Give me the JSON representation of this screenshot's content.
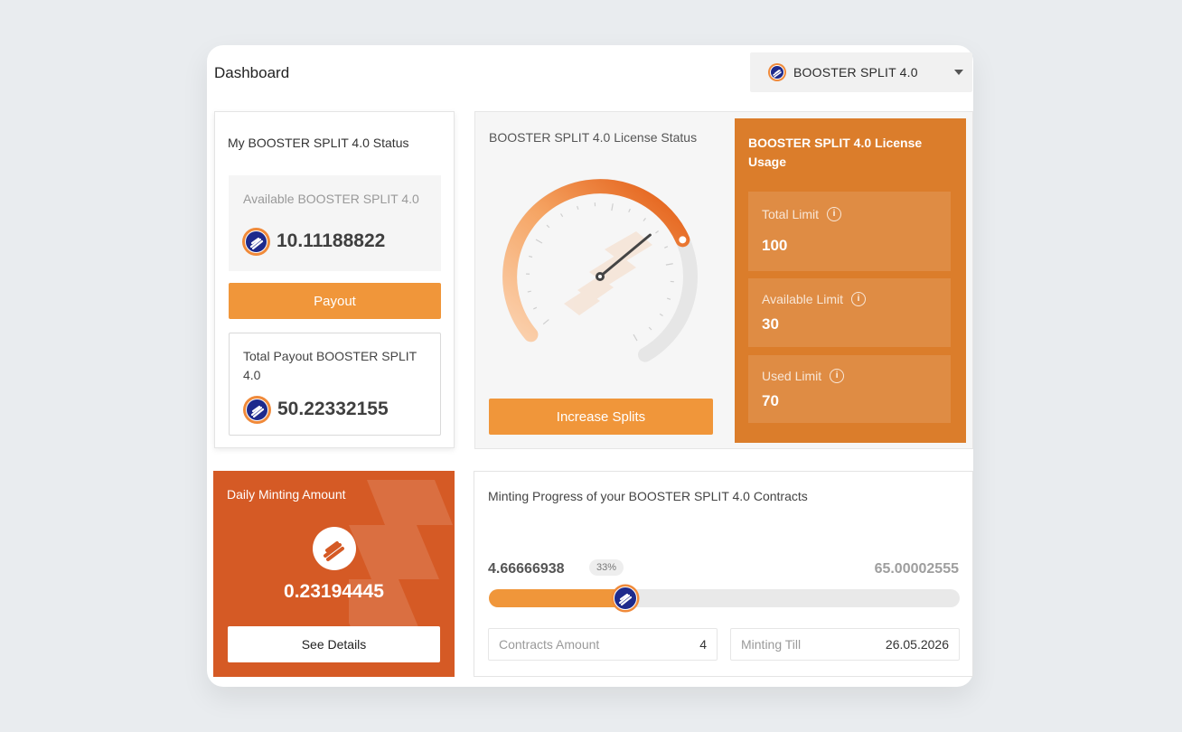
{
  "header": {
    "title": "Dashboard"
  },
  "selector": {
    "label": "BOOSTER SPLIT 4.0"
  },
  "status": {
    "title": "My BOOSTER SPLIT 4.0 Status",
    "available_label": "Available BOOSTER SPLIT 4.0",
    "available_value": "10.11188822",
    "payout_button": "Payout",
    "total_label": "Total Payout BOOSTER SPLIT 4.0",
    "total_value": "50.22332155"
  },
  "license": {
    "title": "BOOSTER SPLIT 4.0 License Status",
    "gauge_level": 0.7,
    "increase_button": "Increase Splits"
  },
  "usage": {
    "title": "BOOSTER SPLIT 4.0 License Usage",
    "total_label": "Total Limit",
    "total_value": "100",
    "available_label": "Available Limit",
    "available_value": "30",
    "used_label": "Used Limit",
    "used_value": "70"
  },
  "minting": {
    "title": "Daily Minting Amount",
    "value": "0.23194445",
    "details_button": "See Details"
  },
  "progress": {
    "title": "Minting Progress of your BOOSTER SPLIT 4.0 Contracts",
    "current": "4.66666938",
    "percent_label": "33%",
    "percent": 0.29,
    "total": "65.00002555",
    "contracts_label": "Contracts Amount",
    "contracts_value": "4",
    "minting_till_label": "Minting Till",
    "minting_till_value": "26.05.2026"
  },
  "colors": {
    "accent": "#f0963a",
    "usage_panel": "#db7d2b",
    "minting_card": "#d55a25",
    "coin_blue": "#1e2a8c"
  },
  "icons": [
    "booster-coin-icon",
    "chevron-down-icon",
    "info-icon"
  ]
}
